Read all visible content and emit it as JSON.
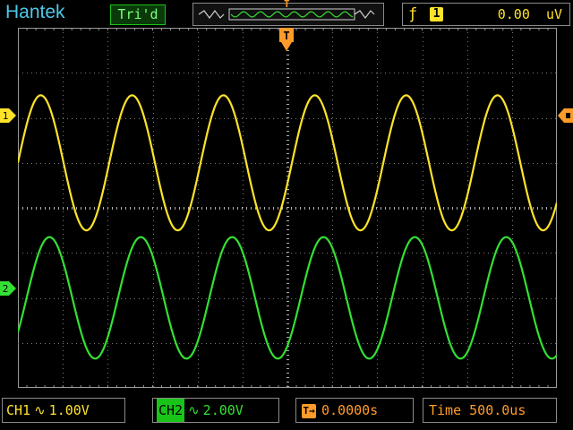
{
  "brand": "Hantek",
  "trigger_state": "Tri'd",
  "memory_bar": {
    "trigger_marker": "T"
  },
  "trigger": {
    "edge_icon": "rising-edge-icon",
    "source": "1",
    "level": "0.00",
    "unit": "uV"
  },
  "markers": {
    "ch1": "1",
    "ch2": "2",
    "trig_position": "T"
  },
  "channels": [
    {
      "name": "CH1",
      "coupling_icon": "ac-coupling-icon",
      "coupling": "∿",
      "scale": "1.00V",
      "color": "#ffe22a",
      "cycles_per_screen": 5.9,
      "amplitude_div": 1.5,
      "offset_div": 1.0
    },
    {
      "name": "CH2",
      "coupling_icon": "ac-coupling-icon",
      "coupling": "∿",
      "scale": "2.00V",
      "color": "#33e033",
      "cycles_per_screen": 5.9,
      "amplitude_div": 1.35,
      "offset_div": -2.0
    }
  ],
  "horizontal": {
    "trigger_position": "0.0000s",
    "timebase_label": "Time",
    "timebase": "500.0us"
  },
  "colors": {
    "grid": "#7a7a7a",
    "ch1": "#ffe22a",
    "ch2": "#33e033",
    "trigger": "#ff9b2a"
  }
}
